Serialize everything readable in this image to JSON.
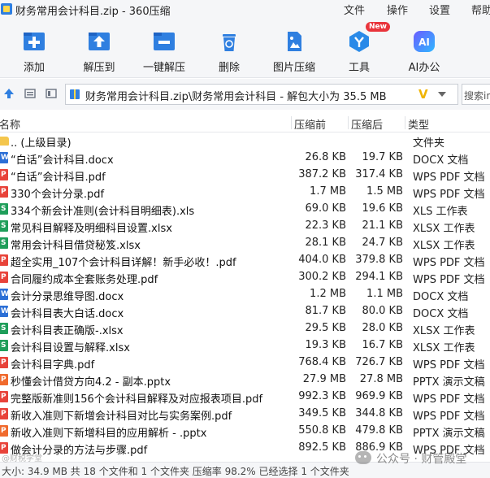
{
  "window": {
    "title": "财务常用会计科目.zip - 360压缩",
    "menu": [
      "文件",
      "操作",
      "设置",
      "帮助"
    ]
  },
  "toolbar": {
    "add": "添加",
    "extract_to": "解压到",
    "one_click_extract": "一键解压",
    "delete": "删除",
    "image_compress": "图片压缩",
    "tools": "工具",
    "tools_badge": "New",
    "ai_office": "AI办公",
    "ai_icon_text": "AI"
  },
  "address": {
    "path": "财务常用会计科目.zip\\财务常用会计科目 - 解包大小为 35.5 MB",
    "v_label": "V",
    "search_placeholder": "搜索in"
  },
  "columns": {
    "name": "名称",
    "size": "压缩前",
    "compressed": "压缩后",
    "type": "类型"
  },
  "files": [
    {
      "name": ".. (上级目录)",
      "size": "",
      "compressed": "",
      "type": "文件夹",
      "kind": "folder"
    },
    {
      "name": "“白话”会计科目.docx",
      "size": "26.8 KB",
      "compressed": "19.7 KB",
      "type": "DOCX 文档",
      "kind": "word"
    },
    {
      "name": "“白话”会计科目.pdf",
      "size": "387.2 KB",
      "compressed": "317.4 KB",
      "type": "WPS PDF 文档",
      "kind": "pdf"
    },
    {
      "name": "330个会计分录.pdf",
      "size": "1.7 MB",
      "compressed": "1.5 MB",
      "type": "WPS PDF 文档",
      "kind": "pdf"
    },
    {
      "name": "334个新会计准则(会计科目明细表).xls",
      "size": "69.0 KB",
      "compressed": "19.6 KB",
      "type": "XLS 工作表",
      "kind": "xls"
    },
    {
      "name": "常见科目解释及明细科目设置.xlsx",
      "size": "22.3 KB",
      "compressed": "21.1 KB",
      "type": "XLSX 工作表",
      "kind": "xls"
    },
    {
      "name": "常用会计科目借贷秘笈.xlsx",
      "size": "28.1 KB",
      "compressed": "24.7 KB",
      "type": "XLSX 工作表",
      "kind": "xls"
    },
    {
      "name": "超全实用_107个会计科目详解！新手必收！.pdf",
      "size": "404.0 KB",
      "compressed": "379.8 KB",
      "type": "WPS PDF 文档",
      "kind": "pdf"
    },
    {
      "name": "合同履约成本全套账务处理.pdf",
      "size": "300.2 KB",
      "compressed": "294.1 KB",
      "type": "WPS PDF 文档",
      "kind": "pdf"
    },
    {
      "name": "会计分录思维导图.docx",
      "size": "1.2 MB",
      "compressed": "1.1 MB",
      "type": "DOCX 文档",
      "kind": "word"
    },
    {
      "name": "会计科目表大白话.docx",
      "size": "81.7 KB",
      "compressed": "80.0 KB",
      "type": "DOCX 文档",
      "kind": "word"
    },
    {
      "name": "会计科目表正确版-.xlsx",
      "size": "29.5 KB",
      "compressed": "28.0 KB",
      "type": "XLSX 工作表",
      "kind": "xls"
    },
    {
      "name": "会计科目设置与解释.xlsx",
      "size": "19.3 KB",
      "compressed": "16.7 KB",
      "type": "XLSX 工作表",
      "kind": "xls"
    },
    {
      "name": "会计科目字典.pdf",
      "size": "768.4 KB",
      "compressed": "726.7 KB",
      "type": "WPS PDF 文档",
      "kind": "pdf"
    },
    {
      "name": "秒懂会计借贷方向4.2 - 副本.pptx",
      "size": "27.9 MB",
      "compressed": "27.8 MB",
      "type": "PPTX 演示文稿",
      "kind": "ppt"
    },
    {
      "name": "完整版新准则156个会计科目解释及对应报表项目.pdf",
      "size": "992.3 KB",
      "compressed": "969.9 KB",
      "type": "WPS PDF 文档",
      "kind": "pdf"
    },
    {
      "name": "新收入准则下新增会计科目对比与实务案例.pdf",
      "size": "349.5 KB",
      "compressed": "344.8 KB",
      "type": "WPS PDF 文档",
      "kind": "pdf"
    },
    {
      "name": "新收入准则下新增科目的应用解析 - .pptx",
      "size": "550.8 KB",
      "compressed": "479.8 KB",
      "type": "PPTX 演示文稿",
      "kind": "ppt"
    },
    {
      "name": "做会计分录的方法与步骤.pdf",
      "size": "892.5 KB",
      "compressed": "886.9 KB",
      "type": "WPS PDF 文档",
      "kind": "pdf"
    }
  ],
  "icon_glyphs": {
    "word": "W",
    "pdf": "P",
    "xls": "S",
    "ppt": "P",
    "folder": ""
  },
  "status": {
    "text": "大小: 34.9 MB 共 18 个文件和 1 个文件夹 压缩率 98.2% 已经选择 1 个文件夹"
  },
  "watermark": {
    "text": "公众号 · 财管殿堂",
    "small": "@财税学堂"
  },
  "colors": {
    "accent_blue": "#2f7fe0",
    "word": "#2b6fd6",
    "pdf": "#e8433a",
    "xls": "#1f9e5a",
    "ppt": "#f06a2d",
    "folder": "#f4c64d"
  }
}
